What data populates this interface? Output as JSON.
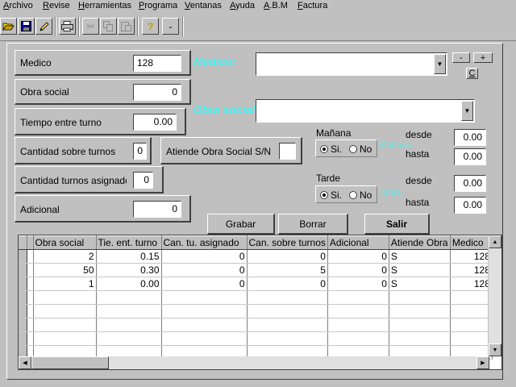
{
  "menu": [
    {
      "label": "Archivo"
    },
    {
      "label": "Revise"
    },
    {
      "label": "Herramientas"
    },
    {
      "label": "Programa"
    },
    {
      "label": "Ventanas"
    },
    {
      "label": "Ayuda"
    },
    {
      "label": "A.B.M"
    },
    {
      "label": "Factura"
    }
  ],
  "toolbar": {
    "help_label": "?",
    "minus_label": "-"
  },
  "form": {
    "medico_label": "Medico",
    "medico_value": "128",
    "obra_social_label": "Obra social",
    "obra_social_value": "0",
    "tiempo_label": "Tiempo entre turno",
    "tiempo_value": "0.00",
    "cantidad_sobre_label": "Cantidad sobre turnos",
    "cantidad_sobre_value": "0",
    "atiende_label": "Atiende Obra Social S/N",
    "atiende_value": "",
    "cantidad_asig_label": "Cantidad turnos asignadо",
    "cantidad_asig_value": "0",
    "adicional_label": "Adicional",
    "adicional_value": "0"
  },
  "lookup": {
    "medico_title": "Medico:",
    "medico_combo_value": "",
    "obra_title": "Obra social:",
    "obra_combo_value": "",
    "minus_label": "-",
    "plus_label": "+",
    "c_label": "C"
  },
  "manana": {
    "title": "Mañana",
    "si_label": "Si.",
    "no_label": "No",
    "selected": "si",
    "ghost_label": "Mañana",
    "desde_label": "desde",
    "desde_value": "0.00",
    "hasta_label": "hasta",
    "hasta_value": "0.00"
  },
  "tarde": {
    "title": "Tarde",
    "si_label": "Si.",
    "no_label": "No",
    "selected": "si",
    "ghost_label": "Tarde",
    "desde_label": "desde",
    "desde_value": "0.00",
    "hasta_label": "hasta",
    "hasta_value": "0.00"
  },
  "actions": {
    "grabar": "Grabar",
    "borrar": "Borrar",
    "salir": "Salir"
  },
  "grid": {
    "columns": [
      "Obra social",
      "Tie. ent. turno",
      "Can. tu. asignado",
      "Can. sobre turnos",
      "Adicional",
      "Atiende Obra",
      "Medico"
    ],
    "rows": [
      [
        "2",
        "0.15",
        "0",
        "0",
        "0",
        "S",
        "128"
      ],
      [
        "50",
        "0.30",
        "0",
        "5",
        "0",
        "S",
        "128"
      ],
      [
        "1",
        "0.00",
        "0",
        "0",
        "0",
        "S",
        "128"
      ]
    ],
    "empty_rows": 5
  }
}
